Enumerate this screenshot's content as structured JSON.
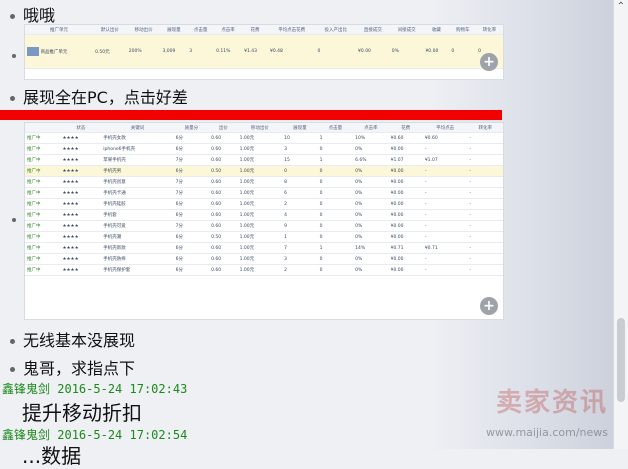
{
  "messages": [
    {
      "text": "哦哦"
    },
    {
      "text": "展现全在PC，点击好差"
    },
    {
      "text": "无线基本没展现"
    },
    {
      "text": "鬼哥，求指点下"
    }
  ],
  "replies": [
    {
      "author": "鑫锋鬼剑",
      "time": "2016-5-24 17:02:43",
      "text": "提升移动折扣"
    },
    {
      "author": "鑫锋鬼剑",
      "time": "2016-5-24 17:02:54",
      "text": "...数据"
    }
  ],
  "screenshot1": {
    "headers": [
      "推广单元",
      "默认出价",
      "移动出价",
      "展现量",
      "点击量",
      "点击率",
      "花费",
      "平均点击花费",
      "投入产出比",
      "直接成交",
      "间接成交",
      "收藏",
      "购物车",
      "转化率"
    ],
    "row": [
      "商品推广单元",
      "0.50元",
      "200%",
      "3,009",
      "3",
      "0.11%",
      "¥1.43",
      "¥0.48",
      "0",
      "¥0.00",
      "0%",
      "¥0.00",
      "0",
      "0"
    ]
  },
  "screenshot2": {
    "headers": [
      "",
      "状态",
      "关键词",
      "质量分",
      "出价",
      "移动出价",
      "展现量",
      "点击量",
      "点击率",
      "花费",
      "平均点击",
      "转化率"
    ],
    "rows": [
      [
        "推广中",
        "★★★★",
        "手机壳女款",
        "6分",
        "0.60",
        "1.00元",
        "10",
        "1",
        "10%",
        "¥0.60",
        "¥0.60",
        "-"
      ],
      [
        "推广中",
        "★★★★",
        "iphone6手机壳",
        "6分",
        "0.60",
        "1.00元",
        "3",
        "0",
        "0%",
        "¥0.00",
        "-",
        "-"
      ],
      [
        "推广中",
        "★★★★",
        "苹果手机壳",
        "7分",
        "0.60",
        "1.00元",
        "15",
        "1",
        "6.6%",
        "¥1.07",
        "¥1.07",
        "-"
      ],
      [
        "推广中",
        "★★★★",
        "手机壳男",
        "6分",
        "0.50",
        "1.00元",
        "0",
        "0",
        "0%",
        "¥0.00",
        "-",
        "-"
      ],
      [
        "推广中",
        "★★★★",
        "手机壳创意",
        "7分",
        "0.60",
        "1.00元",
        "8",
        "0",
        "0%",
        "¥0.00",
        "-",
        "-"
      ],
      [
        "推广中",
        "★★★★",
        "手机壳卡通",
        "7分",
        "0.60",
        "1.00元",
        "6",
        "0",
        "0%",
        "¥0.00",
        "-",
        "-"
      ],
      [
        "推广中",
        "★★★★",
        "手机壳硅胶",
        "6分",
        "0.60",
        "1.00元",
        "2",
        "0",
        "0%",
        "¥0.00",
        "-",
        "-"
      ],
      [
        "推广中",
        "★★★★",
        "手机套",
        "6分",
        "0.60",
        "1.00元",
        "4",
        "0",
        "0%",
        "¥0.00",
        "-",
        "-"
      ],
      [
        "推广中",
        "★★★★",
        "手机壳可爱",
        "7分",
        "0.60",
        "1.00元",
        "9",
        "0",
        "0%",
        "¥0.00",
        "-",
        "-"
      ],
      [
        "推广中",
        "★★★★",
        "手机壳潮",
        "6分",
        "0.50",
        "1.00元",
        "1",
        "0",
        "0%",
        "¥0.00",
        "-",
        "-"
      ],
      [
        "推广中",
        "★★★★",
        "手机壳新款",
        "6分",
        "0.60",
        "1.00元",
        "7",
        "1",
        "14%",
        "¥0.71",
        "¥0.71",
        "-"
      ],
      [
        "推广中",
        "★★★★",
        "手机壳防摔",
        "6分",
        "0.60",
        "1.00元",
        "3",
        "0",
        "0%",
        "¥0.00",
        "-",
        "-"
      ],
      [
        "推广中",
        "★★★★",
        "手机壳保护套",
        "6分",
        "0.60",
        "1.00元",
        "2",
        "0",
        "0%",
        "¥0.00",
        "-",
        "-"
      ]
    ]
  },
  "watermark": {
    "brand": "卖家资讯",
    "url": "www.maijia.com/news"
  }
}
